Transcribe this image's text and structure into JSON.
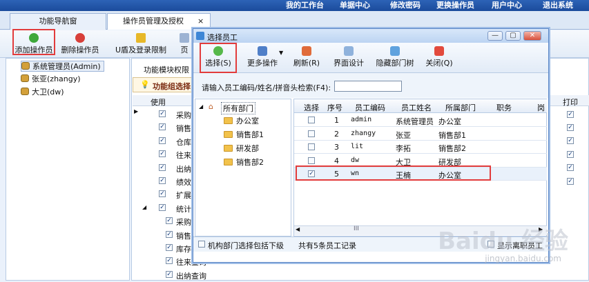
{
  "topnav": [
    "我的工作台",
    "单据中心",
    "修改密码",
    "更换操作员",
    "用户中心",
    "退出系统"
  ],
  "tabs": {
    "nav": "功能导航窗",
    "ops": "操作员管理及授权",
    "close": "×"
  },
  "toolbar": {
    "add": "添加操作员",
    "delete": "删除操作员",
    "login_limit": "U盾及登录限制",
    "more_partial": "页"
  },
  "operators": [
    "系统管理员(Admin)",
    "张亚(zhangy)",
    "大卫(dw)"
  ],
  "mid": {
    "tab_label": "功能模块权限",
    "group_label": "功能组选择",
    "use_header": "使用",
    "print_header": "打印",
    "rows": [
      "采购",
      "销售",
      "仓库",
      "往来",
      "出纳",
      "绩效",
      "扩展",
      "统计",
      "采购",
      "销售",
      "库存",
      "往来查询",
      "出纳查询"
    ]
  },
  "dialog": {
    "title": "选择员工",
    "buttons": {
      "select": "选择(S)",
      "more": "更多操作",
      "refresh": "刷新(R)",
      "design": "界面设计",
      "hide_dept": "隐藏部门树",
      "close": "关闭(Q)"
    },
    "search_label": "请输入员工编码/姓名/拼音头检索(F4):",
    "search_value": "",
    "dept_root": "所有部门",
    "depts": [
      "办公室",
      "销售部1",
      "研发部",
      "销售部2"
    ],
    "columns": [
      "选择",
      "序号",
      "员工编码",
      "员工姓名",
      "所属部门",
      "职务",
      "岗"
    ],
    "rows": [
      {
        "seq": "1",
        "code": "admin",
        "name": "系统管理员",
        "dept": "办公室",
        "checked": false
      },
      {
        "seq": "2",
        "code": "zhangy",
        "name": "张亚",
        "dept": "销售部1",
        "checked": false
      },
      {
        "seq": "3",
        "code": "lit",
        "name": "李拓",
        "dept": "销售部2",
        "checked": false
      },
      {
        "seq": "4",
        "code": "dw",
        "name": "大卫",
        "dept": "研发部",
        "checked": false
      },
      {
        "seq": "5",
        "code": "wn",
        "name": "王楠",
        "dept": "办公室",
        "checked": true
      }
    ],
    "scroll_label": "III",
    "footer_checkbox": "机构部门选择包括下级",
    "record_count": "共有5条员工记录",
    "show_label": "显示离职员工"
  },
  "watermark": {
    "logo": "Baidu 经验",
    "url": "jingyan.baidu.com"
  },
  "colors": {
    "topbar": "#1b4b9c",
    "highlight": "#e23b3b",
    "selected_row": "#e9f1fb"
  }
}
